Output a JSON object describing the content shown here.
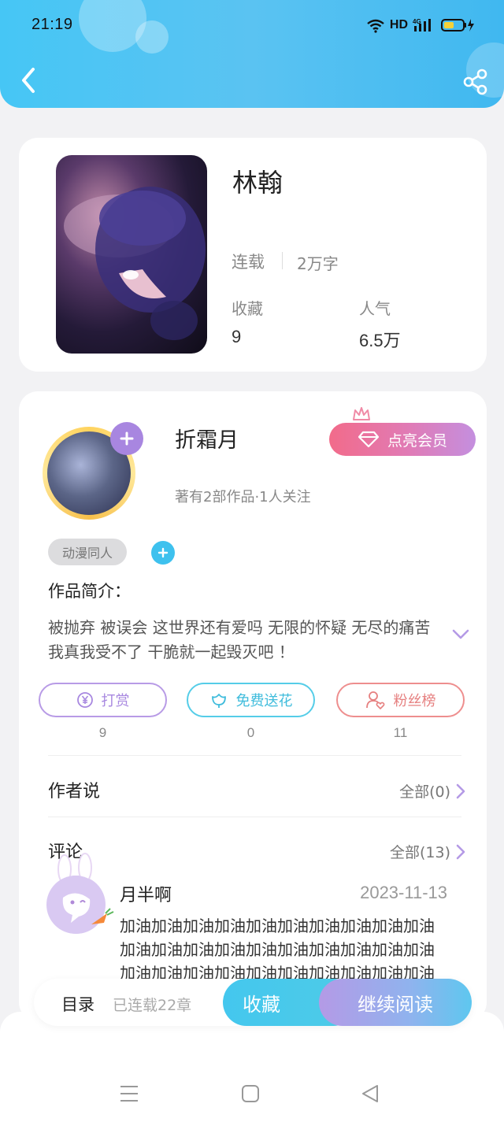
{
  "status_bar": {
    "time": "21:19",
    "network": "HD",
    "signal_label": "4G"
  },
  "book": {
    "title": "林翰",
    "status": "连载",
    "word_count": "2万字",
    "favorites_label": "收藏",
    "favorites_value": "9",
    "popularity_label": "人气",
    "popularity_value": "6.5万"
  },
  "author": {
    "name": "折霜月",
    "meta": "著有2部作品·1人关注",
    "vip_label": "点亮会员",
    "tag": "动漫同人"
  },
  "intro": {
    "label": "作品简介：",
    "text": "被抛弃  被误会 这世界还有爱吗 无限的怀疑 无尽的痛苦 我真我受不了 干脆就一起毁灭吧 ！"
  },
  "actions": [
    {
      "label": "打赏",
      "count": "9"
    },
    {
      "label": "免费送花",
      "count": "0"
    },
    {
      "label": "粉丝榜",
      "count": "11"
    }
  ],
  "author_says": {
    "title": "作者说",
    "more": "全部(0)"
  },
  "comments": {
    "title": "评论",
    "more": "全部(13)",
    "items": [
      {
        "user": "月半啊",
        "date": "2023-11-13",
        "text": "加油加油加油加油加油加油加油加油加油加油加油加油加油加油加油加油加油加油加油加油加油加油加油加油加油加油加油加油加油加油加油加油加油加油加油加油加油加油加油加油加油加油加油加油加油加油"
      }
    ]
  },
  "bottom_bar": {
    "toc_label": "目录",
    "serial_label": "已连载22章",
    "favorite_button": "收藏",
    "continue_button": "继续阅读"
  },
  "colors": {
    "header_blue": "#46c6f5",
    "accent_purple": "#a886e0",
    "accent_cyan": "#3ec1ee",
    "accent_pink": "#e68080"
  },
  "icons": [
    "back-icon",
    "share-icon",
    "plus-icon",
    "diamond-icon",
    "crown-icon",
    "yen-icon",
    "flower-icon",
    "fans-icon",
    "chevron-right-icon",
    "chevron-down-icon",
    "menu-icon",
    "home-square-icon",
    "back-triangle-icon"
  ]
}
